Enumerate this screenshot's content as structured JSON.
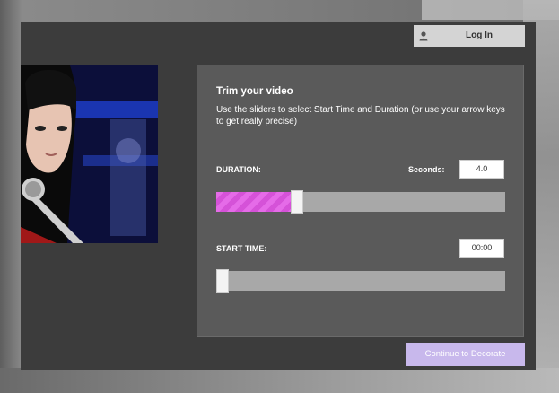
{
  "header": {
    "login_label": "Log In"
  },
  "panel": {
    "title": "Trim your video",
    "description": "Use the sliders to select Start Time and Duration (or use your arrow keys to get really precise)",
    "duration": {
      "label": "DURATION:",
      "seconds_label": "Seconds:",
      "value": "4.0",
      "slider_fraction": 0.27
    },
    "start_time": {
      "label": "START TIME:",
      "value": "00:00",
      "slider_fraction": 0.0
    }
  },
  "footer": {
    "continue_label": "Continue to Decorate"
  },
  "colors": {
    "modal_bg": "#3c3c3c",
    "panel_bg": "#5a5a5a",
    "duration_fill": "#e56be8",
    "continue_bg": "#c8b8ec"
  },
  "icons": {
    "login": "user-icon"
  }
}
